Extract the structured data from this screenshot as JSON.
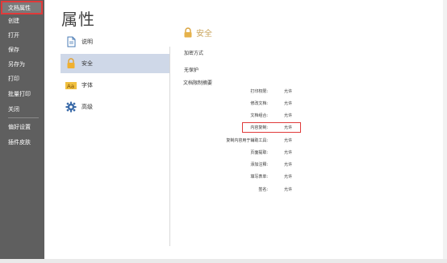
{
  "sidebar": {
    "items": [
      {
        "label": "文档属性"
      },
      {
        "label": "创建"
      },
      {
        "label": "打开"
      },
      {
        "label": "保存"
      },
      {
        "label": "另存为"
      },
      {
        "label": "打印"
      },
      {
        "label": "批量打印"
      },
      {
        "label": "关闭"
      },
      {
        "label": "偏好设置"
      },
      {
        "label": "插件皮肤"
      }
    ]
  },
  "page": {
    "title": "属性",
    "nav": [
      {
        "label": "说明",
        "icon": "document-icon"
      },
      {
        "label": "安全",
        "icon": "lock-icon"
      },
      {
        "label": "字体",
        "icon": "font-icon"
      },
      {
        "label": "高级",
        "icon": "gear-icon"
      }
    ]
  },
  "security": {
    "title": "安全",
    "encryption_label": "加密方式",
    "encryption_value": "无保护",
    "summary_label": "文档限制摘要",
    "permissions": [
      {
        "name": "打印权限:",
        "value": "允许"
      },
      {
        "name": "修改文档:",
        "value": "允许"
      },
      {
        "name": "文档组合:",
        "value": "允许"
      },
      {
        "name": "内容复制:",
        "value": "允许"
      },
      {
        "name": "复制内容用于辅助工具:",
        "value": "允许"
      },
      {
        "name": "页面提取:",
        "value": "允许"
      },
      {
        "name": "添加注释:",
        "value": "允许"
      },
      {
        "name": "填写表单:",
        "value": "允许"
      },
      {
        "name": "签名:",
        "value": "允许"
      }
    ]
  },
  "colors": {
    "sidebar": "#5f5f5f",
    "accent": "#c9a35a",
    "highlight": "#e03a3a",
    "selected": "#cfd8e8"
  }
}
